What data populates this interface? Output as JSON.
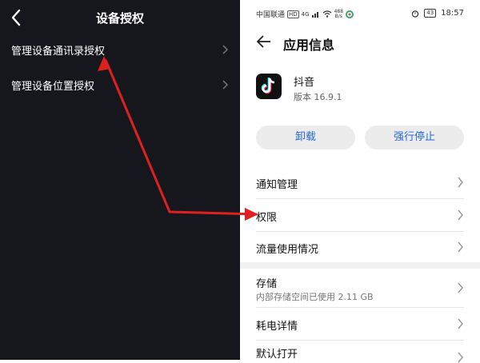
{
  "left": {
    "title": "设备授权",
    "items": [
      {
        "label": "管理设备通讯录授权"
      },
      {
        "label": "管理设备位置授权"
      }
    ]
  },
  "statusbar": {
    "carrier": "中国联通",
    "hd": "HD",
    "signal": "4G",
    "speed_value": "488",
    "speed_unit": "B/s",
    "battery": "43",
    "time": "18:57"
  },
  "right": {
    "title": "应用信息",
    "app_name": "抖音",
    "app_version": "版本 16.9.1",
    "uninstall": "卸载",
    "force_stop": "强行停止",
    "rows": [
      {
        "label": "通知管理"
      },
      {
        "label": "权限"
      },
      {
        "label": "流量使用情况"
      },
      {
        "label": "存储",
        "sub": "内部存储空间已使用 2.11 GB"
      },
      {
        "label": "耗电详情"
      },
      {
        "label": "默认打开"
      }
    ]
  },
  "colors": {
    "left_bg": "#16161d",
    "accent_blue": "#2468d8",
    "annotation_red": "#e02020"
  }
}
